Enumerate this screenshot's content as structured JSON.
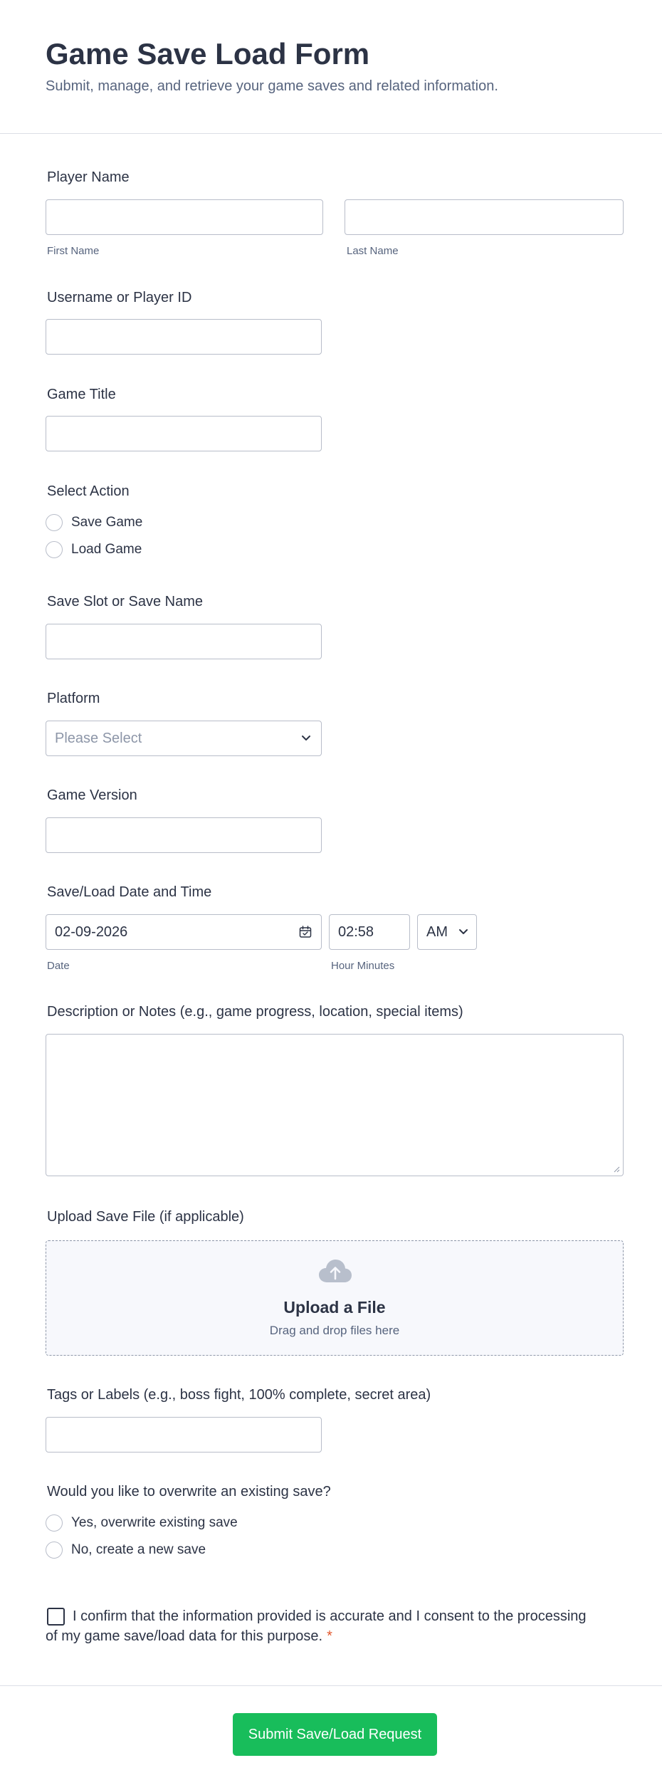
{
  "header": {
    "title": "Game Save Load Form",
    "subtitle": "Submit, manage, and retrieve your game saves and related information."
  },
  "player_name": {
    "label": "Player Name",
    "first_sublabel": "First Name",
    "last_sublabel": "Last Name"
  },
  "username": {
    "label": "Username or Player ID"
  },
  "game_title": {
    "label": "Game Title"
  },
  "select_action": {
    "label": "Select Action",
    "options": [
      "Save Game",
      "Load Game"
    ]
  },
  "save_slot": {
    "label": "Save Slot or Save Name"
  },
  "platform": {
    "label": "Platform",
    "placeholder": "Please Select"
  },
  "game_version": {
    "label": "Game Version"
  },
  "datetime": {
    "label": "Save/Load Date and Time",
    "date_value": "02-09-2026",
    "time_value": "02:58",
    "ampm_value": "AM",
    "date_sublabel": "Date",
    "time_sublabel": "Hour Minutes"
  },
  "notes": {
    "label": "Description or Notes (e.g., game progress, location, special items)"
  },
  "upload": {
    "label": "Upload Save File (if applicable)",
    "title": "Upload a File",
    "hint": "Drag and drop files here"
  },
  "tags": {
    "label": "Tags or Labels (e.g., boss fight, 100% complete, secret area)"
  },
  "overwrite": {
    "label": "Would you like to overwrite an existing save?",
    "options": [
      "Yes, overwrite existing save",
      "No, create a new save"
    ]
  },
  "consent": {
    "text": "I confirm that the information provided is accurate and I consent to the processing of my game save/load data for this purpose.",
    "required_mark": "*"
  },
  "submit": {
    "label": "Submit Save/Load Request"
  },
  "colors": {
    "accent": "#18bd5b",
    "text": "#2c3345",
    "muted": "#57647e",
    "border": "#b8bdc9",
    "required": "#e2582d"
  }
}
